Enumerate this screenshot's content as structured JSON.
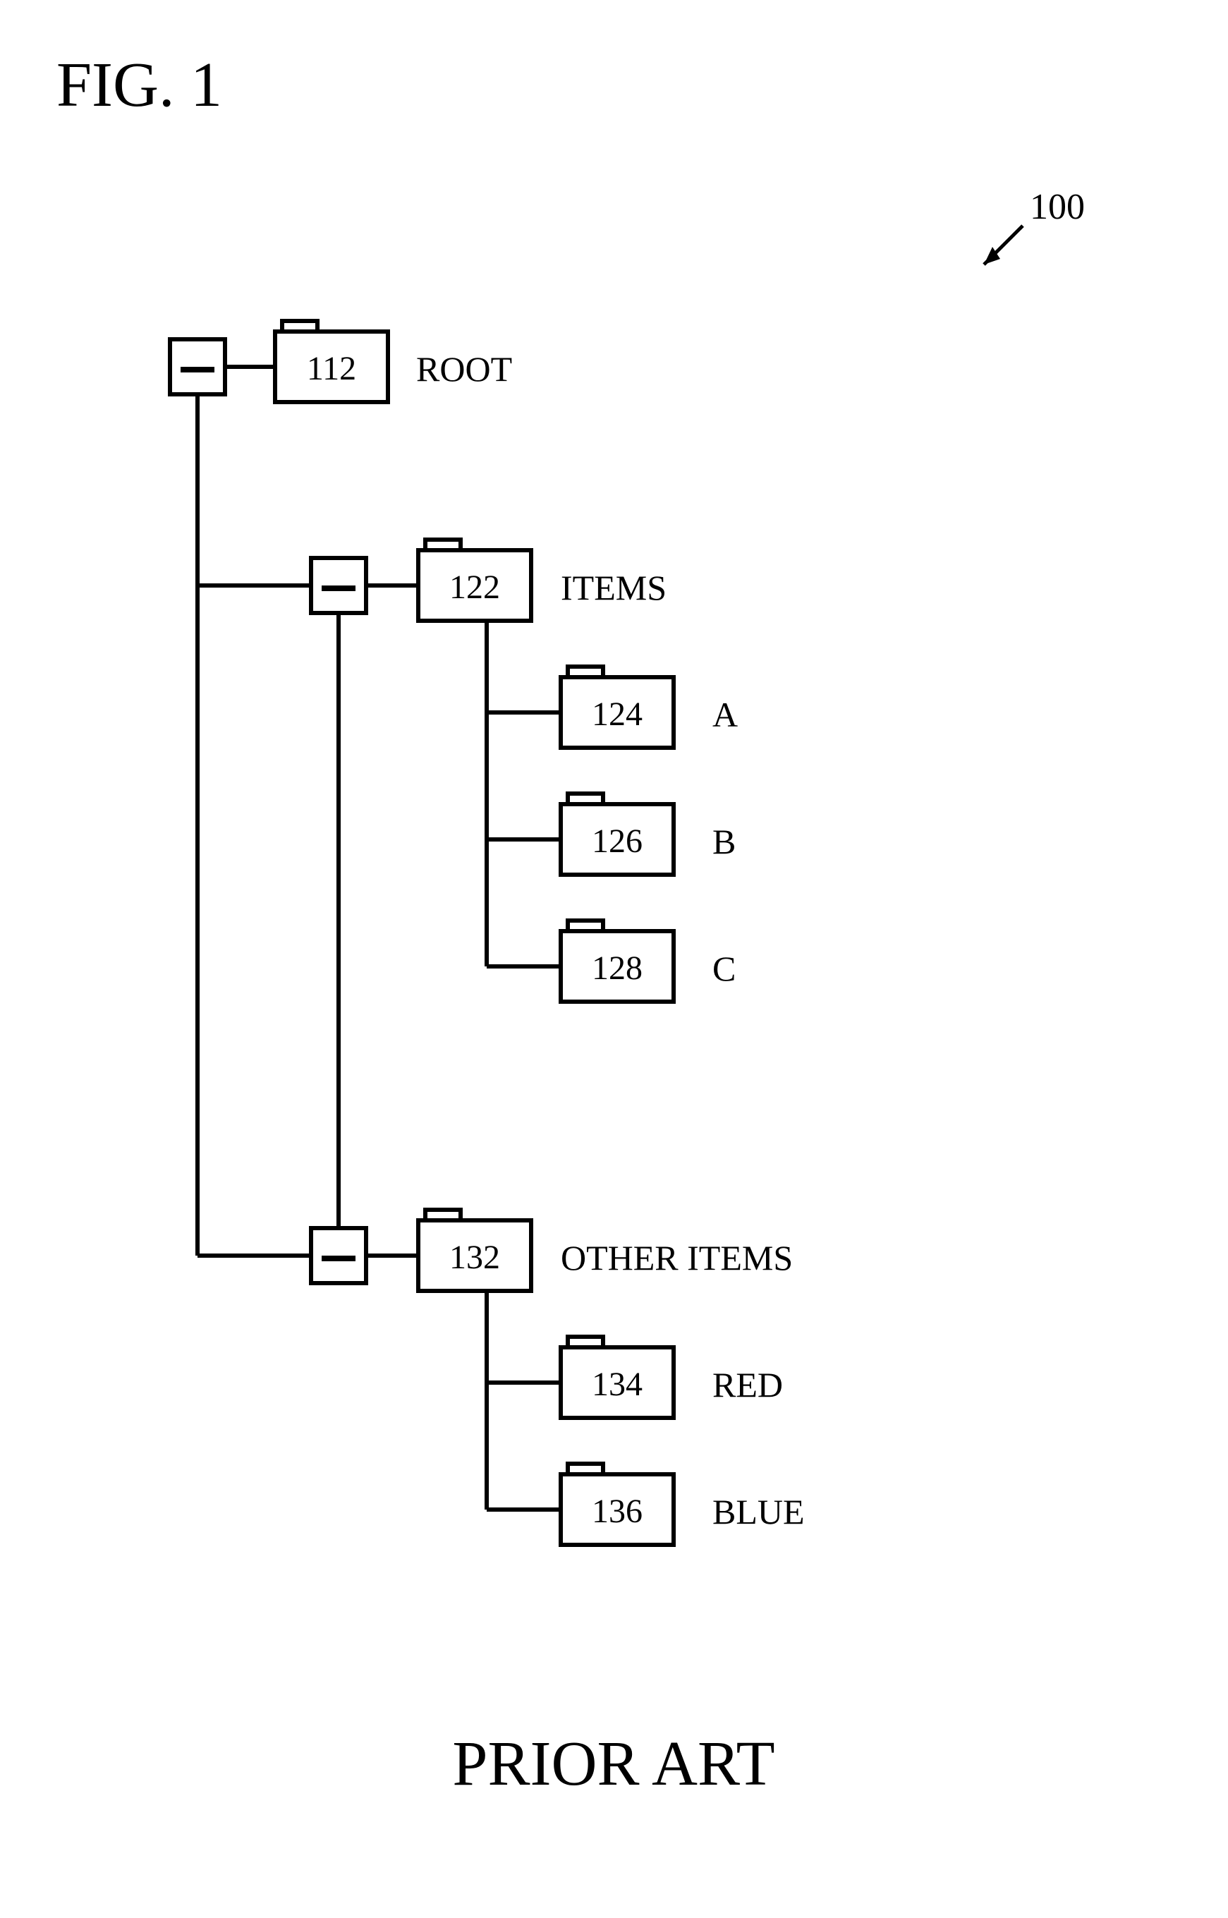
{
  "figure": {
    "title": "FIG. 1",
    "footer": "PRIOR ART",
    "ref_label": "100"
  },
  "tree": {
    "root": {
      "num": "112",
      "name": "ROOT"
    },
    "items": {
      "num": "122",
      "name": "ITEMS"
    },
    "item_a": {
      "num": "124",
      "name": "A"
    },
    "item_b": {
      "num": "126",
      "name": "B"
    },
    "item_c": {
      "num": "128",
      "name": "C"
    },
    "other_items": {
      "num": "132",
      "name": "OTHER ITEMS"
    },
    "red": {
      "num": "134",
      "name": "RED"
    },
    "blue": {
      "num": "136",
      "name": "BLUE"
    }
  }
}
